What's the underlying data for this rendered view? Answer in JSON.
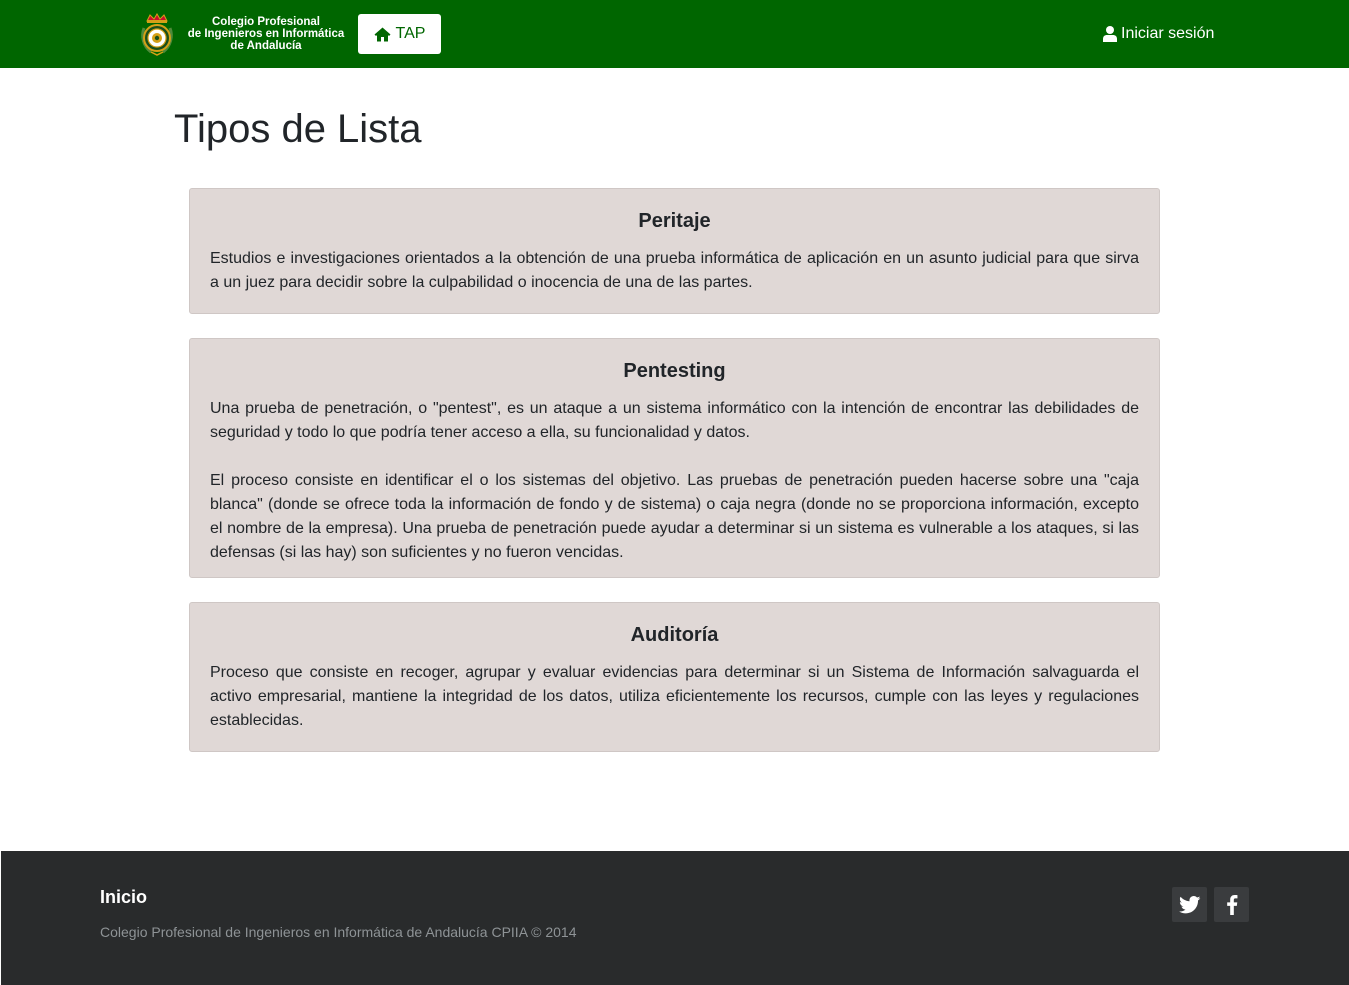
{
  "header": {
    "brand_lines": [
      "Colegio Profesional",
      "de Ingenieros en Informática",
      "de Andalucía"
    ],
    "home_button_label": "TAP",
    "login_label": "Iniciar sesión",
    "colors": {
      "navbar_bg": "#006600",
      "button_bg": "#ffffff",
      "button_text": "#006600"
    },
    "icons": [
      "crest-logo",
      "home-icon",
      "user-icon"
    ]
  },
  "main": {
    "title": "Tipos de Lista",
    "card_bg": "#e0d8d6",
    "cards": [
      {
        "title": "Peritaje",
        "paragraphs": [
          "Estudios e investigaciones orientados a la obtención de una prueba informática de aplicación en un asunto judicial para que sirva a un juez para decidir sobre la culpabilidad o inocencia de una de las partes."
        ]
      },
      {
        "title": "Pentesting",
        "paragraphs": [
          "Una prueba de penetración, o \"pentest\", es un ataque a un sistema informático con la intención de encontrar las debilidades de seguridad y todo lo que podría tener acceso a ella, su funcionalidad y datos.",
          "El proceso consiste en identificar el o los sistemas del objetivo. Las pruebas de penetración pueden hacerse sobre una \"caja blanca\" (donde se ofrece toda la información de fondo y de sistema) o caja negra (donde no se proporciona información, excepto el nombre de la empresa). Una prueba de penetración puede ayudar a determinar si un sistema es vulnerable a los ataques, si las defensas (si las hay) son suficientes y no fueron vencidas."
        ]
      },
      {
        "title": "Auditoría",
        "paragraphs": [
          "Proceso que consiste en recoger, agrupar y evaluar evidencias para determinar si un Sistema de Información salvaguarda el activo empresarial, mantiene la integridad de los datos, utiliza eficientemente los recursos, cumple con las leyes y regulaciones establecidas."
        ]
      }
    ]
  },
  "footer": {
    "link_label": "Inicio",
    "copyright": "Colegio Profesional de Ingenieros en Informática de Andalucía CPIIA © 2014",
    "bg": "#292b2c",
    "icons": [
      "twitter-icon",
      "facebook-icon"
    ]
  }
}
